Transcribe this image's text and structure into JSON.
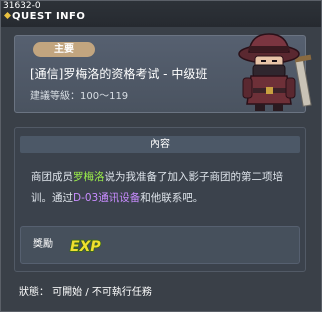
{
  "titlebar": {
    "quest_id": "31632-0",
    "title": "QUEST INFO"
  },
  "quest": {
    "category_badge": "主要",
    "title": "[通信]罗梅洛的资格考试 - 中级班",
    "level_label": "建議等級：",
    "level_range": "100～119"
  },
  "content": {
    "section_title": "內容",
    "desc_part1": "商团成员",
    "desc_name": "罗梅洛",
    "desc_part2": "说为我准备了加入影子商团的第二项培训。通过",
    "desc_item": "D-03通讯设备",
    "desc_part3": "和他联系吧。"
  },
  "reward": {
    "label": "獎勵",
    "icon": "exp-icon",
    "exp_text": "EXP"
  },
  "status": {
    "text": "狀態： 可開始 / 不可執行任務"
  },
  "colors": {
    "badge": "#c2a57f",
    "highlight_green": "#9cf04a",
    "highlight_purple": "#c88cff",
    "exp_yellow": "#f0e030"
  }
}
